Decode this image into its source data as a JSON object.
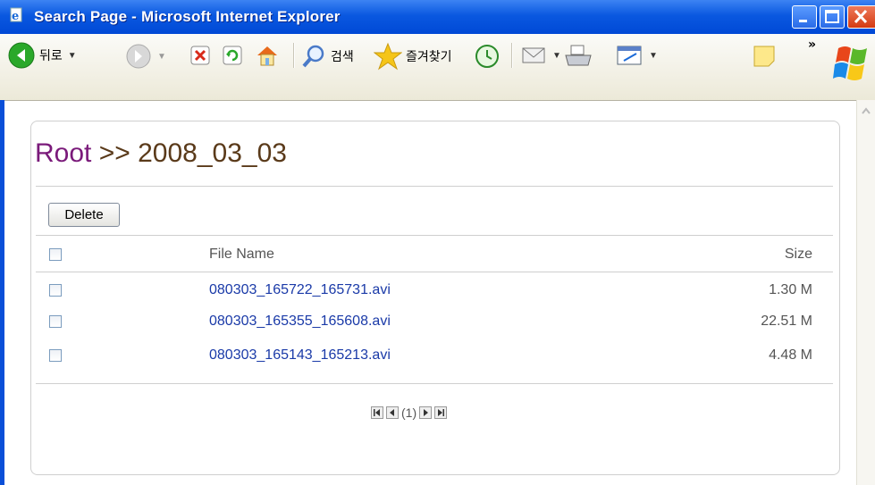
{
  "window": {
    "title": "Search Page - Microsoft Internet Explorer"
  },
  "toolbar": {
    "back_label": "뒤로",
    "search_label": "검색",
    "favorites_label": "즐겨찾기",
    "overflow_label": "»"
  },
  "page": {
    "breadcrumb_root": "Root",
    "breadcrumb_sep": " >> ",
    "breadcrumb_current": "2008_03_03",
    "delete_label": "Delete"
  },
  "table": {
    "headers": {
      "name": "File Name",
      "size": "Size"
    },
    "rows": [
      {
        "name": "080303_165722_165731.avi",
        "size": "1.30 M",
        "checked": false
      },
      {
        "name": "080303_165355_165608.avi",
        "size": "22.51 M",
        "checked": false
      },
      {
        "name": "080303_165143_165213.avi",
        "size": "4.48 M",
        "checked": false
      }
    ]
  },
  "pager": {
    "current_page": "(1)"
  },
  "colors": {
    "titlebar": "#0a58e0",
    "link": "#1a3aa8",
    "root": "#7a1a7a",
    "heading": "#5a3a1a"
  }
}
